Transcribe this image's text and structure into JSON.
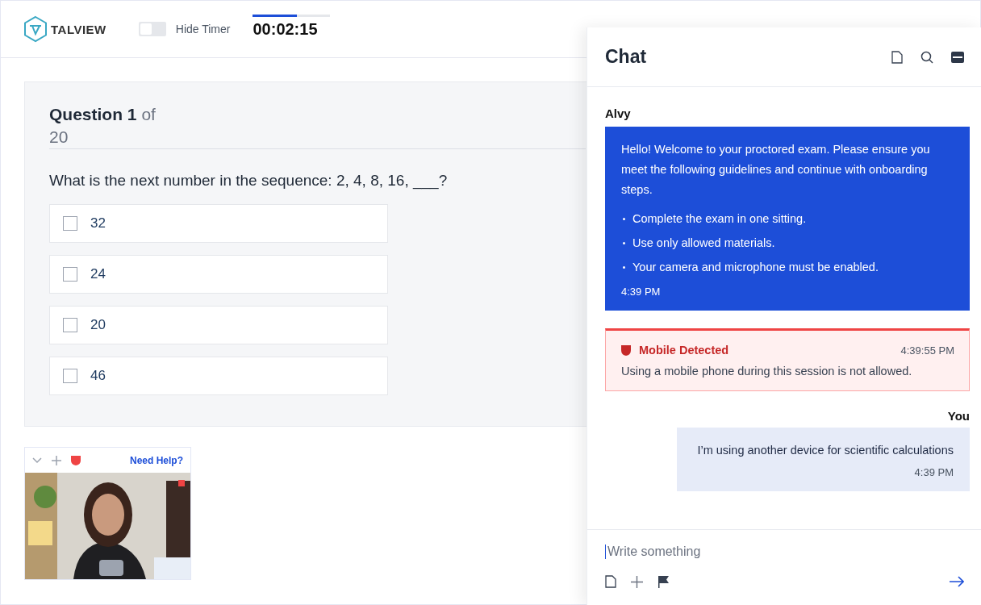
{
  "header": {
    "logo": "TALVIEW",
    "timer_toggle": {
      "label": "Hide Timer",
      "on": false
    },
    "timer": {
      "time": "00:02:15",
      "level": 0.57
    }
  },
  "question": {
    "number": "Question 1",
    "of": "of 20",
    "text": "What is the next number in the sequence: 2, 4, 8, 16, ___?",
    "options": [
      {
        "label": "32",
        "checked": false
      },
      {
        "label": "24",
        "checked": false
      },
      {
        "label": "20",
        "checked": false
      },
      {
        "label": "46",
        "checked": false
      }
    ]
  },
  "webcam": {
    "help": "Need Help?",
    "recording": true
  },
  "chat": {
    "title": "Chat",
    "messages": [
      {
        "kind": "bot",
        "sender": "Alvy",
        "text": "Hello! Welcome to your proctored exam. Please ensure you meet the following guidelines and continue with onboarding steps.",
        "bullets": [
          "Complete the exam in one sitting.",
          "Use only allowed materials.",
          "Your camera and microphone must be enabled."
        ],
        "time": "4:39 PM"
      },
      {
        "kind": "alert",
        "title": "Mobile Detected",
        "time": "4:39:55 PM",
        "text": "Using a mobile phone during this session is not allowed."
      },
      {
        "kind": "user",
        "sender": "You",
        "text": "I’m using another device for scientific calculations",
        "time": "4:39 PM"
      }
    ],
    "input": {
      "placeholder": "Write something"
    }
  }
}
